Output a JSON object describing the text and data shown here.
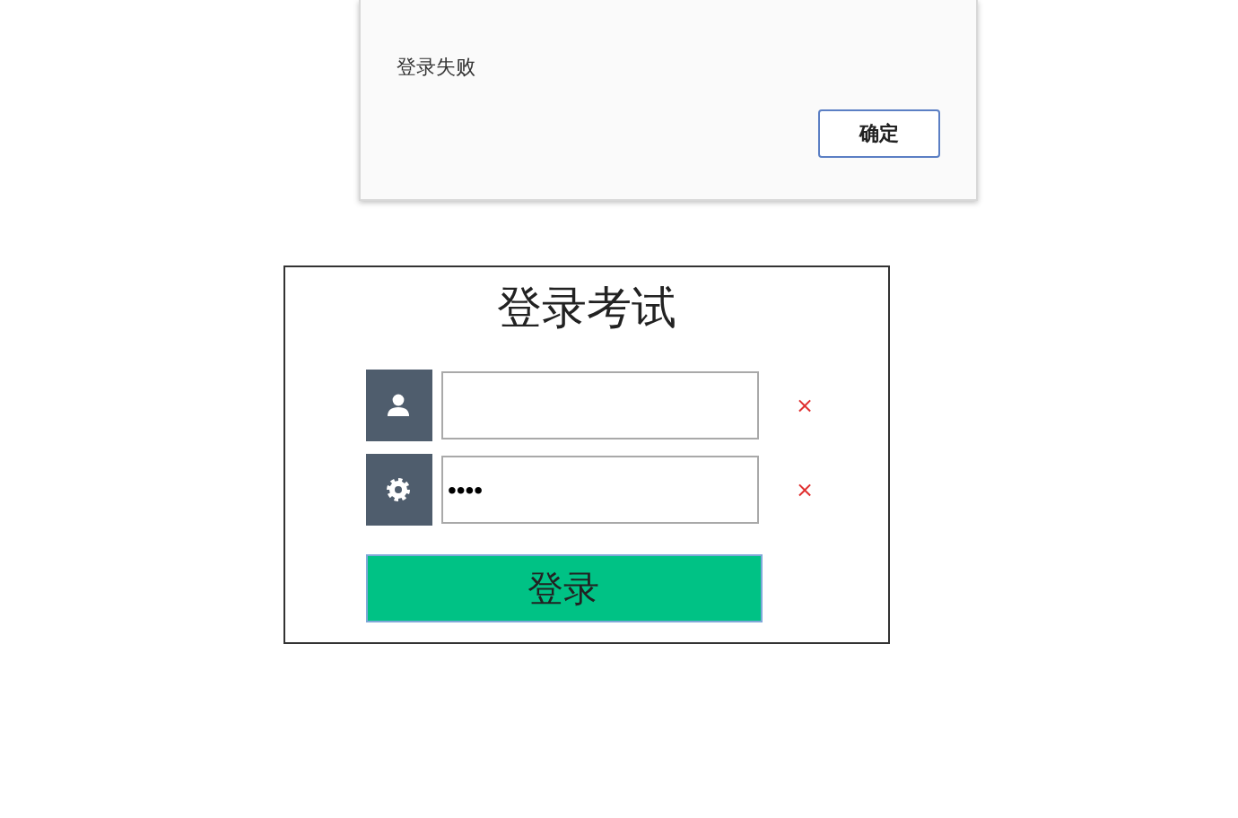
{
  "dialog": {
    "message": "登录失败",
    "button": "确定"
  },
  "login": {
    "title": "登录考试",
    "fields": [
      {
        "kind": "user",
        "error": "×"
      },
      {
        "kind": "password",
        "value": "••••",
        "error": "×"
      }
    ],
    "submit": "登录"
  }
}
